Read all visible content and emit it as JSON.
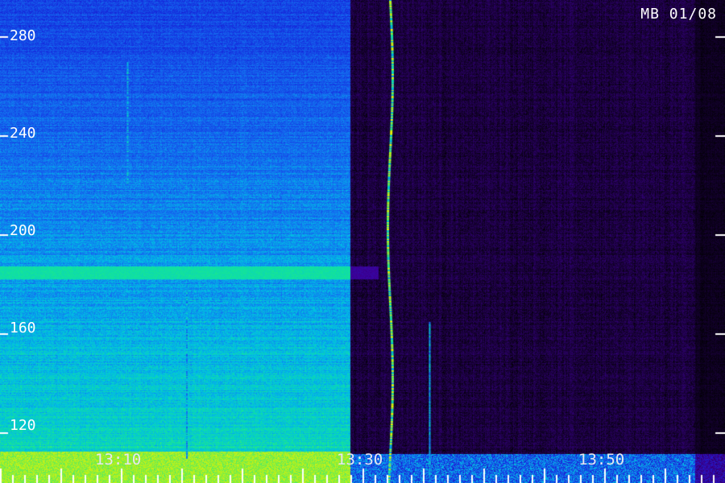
{
  "chart_data": {
    "type": "heatmap",
    "title": "MB 01/08",
    "xlabel": "",
    "ylabel": "",
    "x_tick_labels": [
      "13:10",
      "13:30",
      "13:50"
    ],
    "x_ticks_minutes": [
      790,
      810,
      830
    ],
    "xlim_minutes": [
      780,
      840
    ],
    "y_tick_labels": [
      "280",
      "240",
      "200",
      "160",
      "120"
    ],
    "y_ticks": [
      280,
      240,
      200,
      160,
      120
    ],
    "ylim": [
      100,
      295
    ],
    "segments": [
      {
        "start_minute": 780,
        "end_minute": 809,
        "level": "high-background"
      },
      {
        "start_minute": 809,
        "end_minute": 840,
        "level": "low-background"
      }
    ],
    "features": [
      {
        "kind": "horizontal-band",
        "y": 185,
        "start_minute": 780,
        "end_minute": 810
      },
      {
        "kind": "vertical-burst",
        "minute": 812.2,
        "y_range": [
          100,
          295
        ]
      },
      {
        "kind": "vertical-burst",
        "minute": 795.4,
        "y_range": [
          110,
          180
        ]
      },
      {
        "kind": "vertical-burst",
        "minute": 815.5,
        "y_range": [
          100,
          165
        ]
      },
      {
        "kind": "vertical-burst",
        "minute": 790.5,
        "y_range": [
          220,
          270
        ]
      }
    ],
    "grid": false
  }
}
